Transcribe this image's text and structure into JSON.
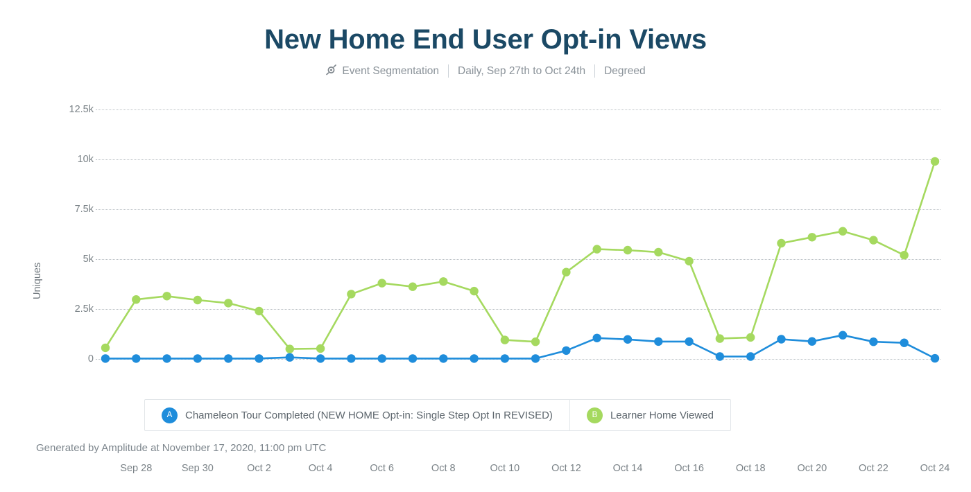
{
  "header": {
    "title": "New Home End User Opt-in Views",
    "icon": "event-segmentation-icon",
    "segment_label": "Event Segmentation",
    "date_range": "Daily, Sep 27th to Oct 24th",
    "project": "Degreed"
  },
  "legend": {
    "items": [
      {
        "badge": "A",
        "label": "Chameleon Tour Completed (NEW HOME Opt-in: Single Step Opt In REVISED)",
        "color": "#1f8ddb"
      },
      {
        "badge": "B",
        "label": "Learner Home Viewed",
        "color": "#a5d95f"
      }
    ]
  },
  "footer": {
    "text": "Generated by Amplitude at November 17, 2020, 11:00 pm UTC"
  },
  "colors": {
    "title": "#1b4965",
    "series_a": "#1f8ddb",
    "series_b": "#a5d95f",
    "grid": "#b9bfc4",
    "axis_text": "#7a8287"
  },
  "chart_data": {
    "type": "line",
    "title": "New Home End User Opt-in Views",
    "subtitle": "Daily, Sep 27th to Oct 24th",
    "xlabel": "",
    "ylabel": "Uniques",
    "ylim": [
      0,
      12500
    ],
    "yticks": [
      0,
      2500,
      5000,
      7500,
      10000,
      12500
    ],
    "ytick_labels": [
      "0",
      "2.5k",
      "5k",
      "7.5k",
      "10k",
      "12.5k"
    ],
    "grid": true,
    "legend_position": "bottom",
    "x": [
      "Sep 27",
      "Sep 28",
      "Sep 29",
      "Sep 30",
      "Oct 1",
      "Oct 2",
      "Oct 3",
      "Oct 4",
      "Oct 5",
      "Oct 6",
      "Oct 7",
      "Oct 8",
      "Oct 9",
      "Oct 10",
      "Oct 11",
      "Oct 12",
      "Oct 13",
      "Oct 14",
      "Oct 15",
      "Oct 16",
      "Oct 17",
      "Oct 18",
      "Oct 19",
      "Oct 20",
      "Oct 21",
      "Oct 22",
      "Oct 23",
      "Oct 24"
    ],
    "xtick_labels": [
      "Sep 28",
      "Sep 30",
      "Oct 2",
      "Oct 4",
      "Oct 6",
      "Oct 8",
      "Oct 10",
      "Oct 12",
      "Oct 14",
      "Oct 16",
      "Oct 18",
      "Oct 20",
      "Oct 22",
      "Oct 24"
    ],
    "xtick_indices": [
      1,
      3,
      5,
      7,
      9,
      11,
      13,
      15,
      17,
      19,
      21,
      23,
      25,
      27
    ],
    "series": [
      {
        "name": "Chameleon Tour Completed (NEW HOME Opt-in: Single Step Opt In REVISED)",
        "badge": "A",
        "color": "#1f8ddb",
        "values": [
          20,
          20,
          20,
          20,
          20,
          20,
          80,
          20,
          20,
          20,
          20,
          20,
          20,
          20,
          20,
          420,
          1050,
          980,
          870,
          870,
          120,
          120,
          990,
          880,
          1190,
          860,
          810,
          30
        ]
      },
      {
        "name": "Learner Home Viewed",
        "badge": "B",
        "color": "#a5d95f",
        "values": [
          560,
          2980,
          3150,
          2950,
          2800,
          2400,
          500,
          520,
          3250,
          3800,
          3620,
          3880,
          3400,
          950,
          860,
          4350,
          5500,
          5450,
          5350,
          4900,
          1020,
          1080,
          5800,
          6100,
          6400,
          5950,
          5200,
          9900
        ]
      }
    ]
  }
}
